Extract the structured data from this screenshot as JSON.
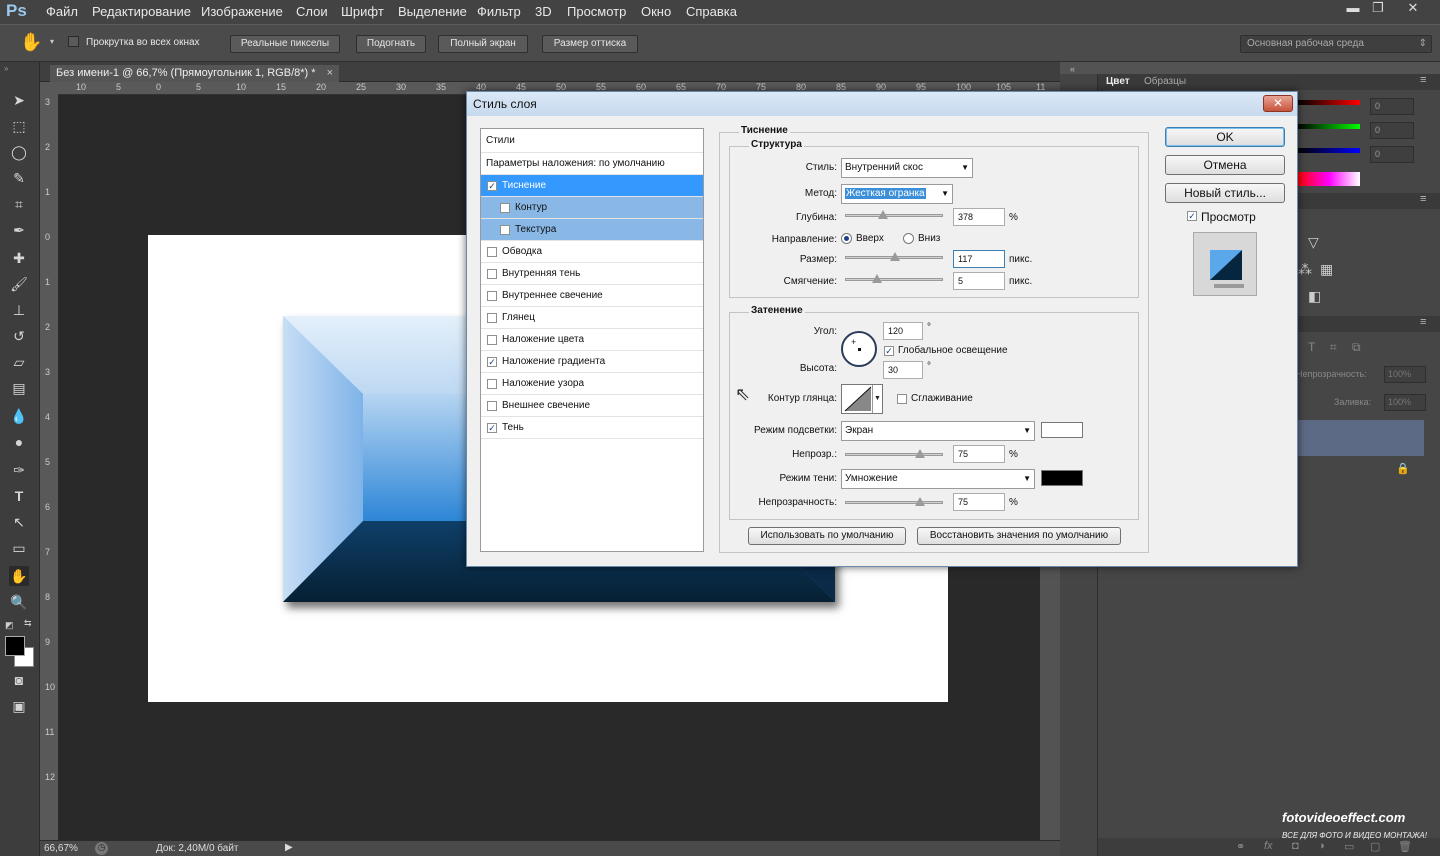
{
  "menubar": {
    "logo": "Ps",
    "items": [
      "Файл",
      "Редактирование",
      "Изображение",
      "Слои",
      "Шрифт",
      "Выделение",
      "Фильтр",
      "3D",
      "Просмотр",
      "Окно",
      "Справка"
    ],
    "win_min": "▬",
    "win_max": "❐",
    "win_close": "✕"
  },
  "options": {
    "scroll_all": "Прокрутка во всех окнах",
    "btn_actual": "Реальные пикселы",
    "btn_fit": "Подогнать",
    "btn_fill": "Полный экран",
    "btn_print": "Размер оттиска",
    "workspace": "Основная рабочая среда"
  },
  "document": {
    "tab_title": "Без имени-1 @ 66,7% (Прямоугольник 1, RGB/8*) *",
    "tab_close": "×",
    "ruler_h": [
      "10",
      "5",
      "0",
      "5",
      "10",
      "15",
      "20",
      "25",
      "30",
      "35",
      "40",
      "45",
      "50",
      "55",
      "60",
      "65",
      "70",
      "75",
      "80",
      "85",
      "90",
      "95",
      "100",
      "105",
      "11"
    ],
    "ruler_v": [
      "3",
      "2",
      "1",
      "0",
      "1",
      "2",
      "3",
      "4",
      "5",
      "6",
      "7",
      "8",
      "9",
      "10",
      "11",
      "12"
    ],
    "zoom": "66,67%",
    "doc_info": "Док: 2,40M/0 байт"
  },
  "right_panel": {
    "tab_color": "Цвет",
    "tab_swatches": "Образцы",
    "r_value": "0",
    "g_value": "0",
    "b_value": "0",
    "opacity_label": "Непрозрачность:",
    "opacity_value": "100%",
    "fill_label": "Заливка:",
    "fill_value": "100%"
  },
  "dialog": {
    "title": "Стиль слоя",
    "close": "✕",
    "styles_header": "Стили",
    "blend_options": "Параметры наложения: по умолчанию",
    "styles": [
      {
        "label": "Тиснение",
        "checked": "✓"
      },
      {
        "label": "Контур",
        "checked": ""
      },
      {
        "label": "Текстура",
        "checked": ""
      },
      {
        "label": "Обводка",
        "checked": ""
      },
      {
        "label": "Внутренняя тень",
        "checked": ""
      },
      {
        "label": "Внутреннее свечение",
        "checked": ""
      },
      {
        "label": "Глянец",
        "checked": ""
      },
      {
        "label": "Наложение цвета",
        "checked": ""
      },
      {
        "label": "Наложение градиента",
        "checked": "✓"
      },
      {
        "label": "Наложение узора",
        "checked": ""
      },
      {
        "label": "Внешнее свечение",
        "checked": ""
      },
      {
        "label": "Тень",
        "checked": "✓"
      }
    ],
    "emboss_title": "Тиснение",
    "structure_title": "Структура",
    "style_label": "Стиль:",
    "style_value": "Внутренний скос",
    "method_label": "Метод:",
    "method_value": "Жесткая огранка",
    "depth_label": "Глубина:",
    "depth_value": "378",
    "percent": "%",
    "direction_label": "Направление:",
    "dir_up": "Вверх",
    "dir_down": "Вниз",
    "size_label": "Размер:",
    "size_value": "117",
    "px": "пикс.",
    "soften_label": "Смягчение:",
    "soften_value": "5",
    "shading_title": "Затенение",
    "angle_label": "Угол:",
    "angle_value": "120",
    "degree": "°",
    "global_light": "Глобальное освещение",
    "altitude_label": "Высота:",
    "altitude_value": "30",
    "gloss_label": "Контур глянца:",
    "antialias": "Сглаживание",
    "highlight_label": "Режим подсветки:",
    "highlight_value": "Экран",
    "highlight_opacity_label": "Непрозр.:",
    "highlight_opacity_value": "75",
    "shadow_label": "Режим тени:",
    "shadow_value": "Умножение",
    "shadow_opacity_label": "Непрозрачность:",
    "shadow_opacity_value": "75",
    "btn_use_default": "Использовать по умолчанию",
    "btn_reset_default": "Восстановить значения по умолчанию",
    "btn_ok": "OK",
    "btn_cancel": "Отмена",
    "btn_new_style": "Новый стиль...",
    "preview_label": "Просмотр",
    "preview_checked": "✓",
    "highlight_color": "#ffffff",
    "shadow_color": "#000000"
  },
  "watermark": {
    "line1": "fotovideoeffect.com",
    "line2": "ВСЕ ДЛЯ ФОТО И ВИДЕО МОНТАЖА!"
  }
}
